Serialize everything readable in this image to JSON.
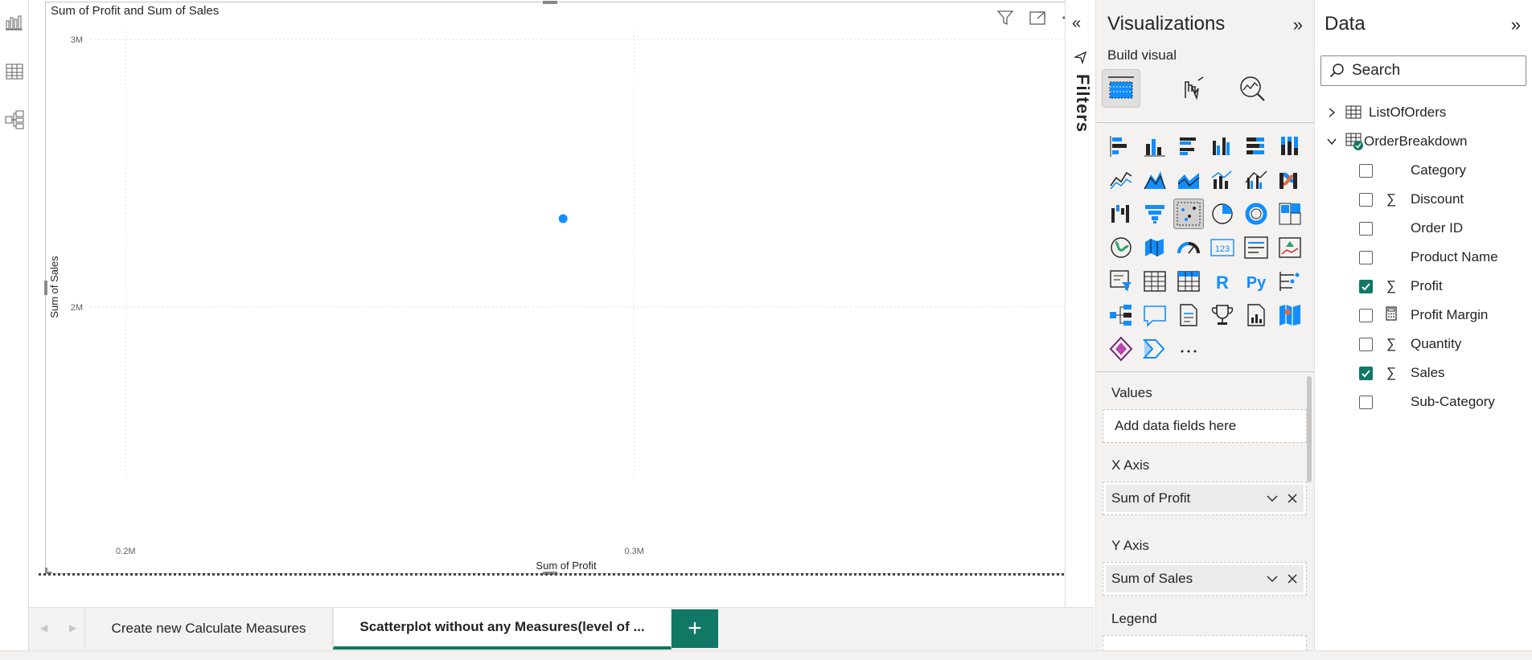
{
  "left_rail": {
    "icons": [
      "report-view-icon",
      "table-view-icon",
      "model-view-icon"
    ]
  },
  "visual": {
    "title": "Sum of Profit and Sum of Sales",
    "toolbar_icons": [
      "filter-icon",
      "focus-mode-icon",
      "more-options-icon"
    ]
  },
  "chart_data": {
    "type": "scatter",
    "title": "Sum of Profit and Sum of Sales",
    "xlabel": "Sum of Profit",
    "ylabel": "Sum of Sales",
    "x_ticks": [
      "0.2M",
      "0.3M"
    ],
    "y_ticks": [
      "3M",
      "2M"
    ],
    "x_tick_values": [
      200000,
      300000
    ],
    "y_tick_values": [
      3000000,
      2000000
    ],
    "xlim": [
      193000,
      344000
    ],
    "ylim": [
      1420000,
      3030000
    ],
    "grid": true,
    "points": [
      {
        "x": 286000,
        "y": 2330000
      }
    ],
    "point_color": "#118DFF"
  },
  "page_tabs": {
    "tabs": [
      {
        "label": "Create new Calculate Measures",
        "active": false
      },
      {
        "label": "Scatterplot without any Measures(level of ...",
        "active": true
      }
    ],
    "add_label": "+"
  },
  "filters": {
    "label": "Filters",
    "collapse_icon": "double-chevron-left-icon"
  },
  "visualizations": {
    "title": "Visualizations",
    "build_label": "Build visual",
    "collapse_icon": "double-chevron-right-icon",
    "values_label": "Values",
    "values_placeholder": "Add data fields here",
    "x_axis_label": "X Axis",
    "x_axis_field": "Sum of Profit",
    "y_axis_label": "Y Axis",
    "y_axis_field": "Sum of Sales",
    "legend_label": "Legend",
    "colors": {
      "primary": "#118DFF",
      "dark": "#252423"
    }
  },
  "data_pane": {
    "title": "Data",
    "search_placeholder": "Search",
    "tables": [
      {
        "name": "ListOfOrders",
        "expanded": false
      },
      {
        "name": "OrderBreakdown",
        "expanded": true
      }
    ],
    "fields": [
      {
        "name": "Category",
        "type": "",
        "checked": false
      },
      {
        "name": "Discount",
        "type": "sigma",
        "checked": false
      },
      {
        "name": "Order ID",
        "type": "",
        "checked": false
      },
      {
        "name": "Product Name",
        "type": "",
        "checked": false
      },
      {
        "name": "Profit",
        "type": "sigma",
        "checked": true
      },
      {
        "name": "Profit Margin",
        "type": "calculator",
        "checked": false
      },
      {
        "name": "Quantity",
        "type": "sigma",
        "checked": false
      },
      {
        "name": "Sales",
        "type": "sigma",
        "checked": true
      },
      {
        "name": "Sub-Category",
        "type": "",
        "checked": false
      }
    ],
    "check_color": "#117865"
  }
}
